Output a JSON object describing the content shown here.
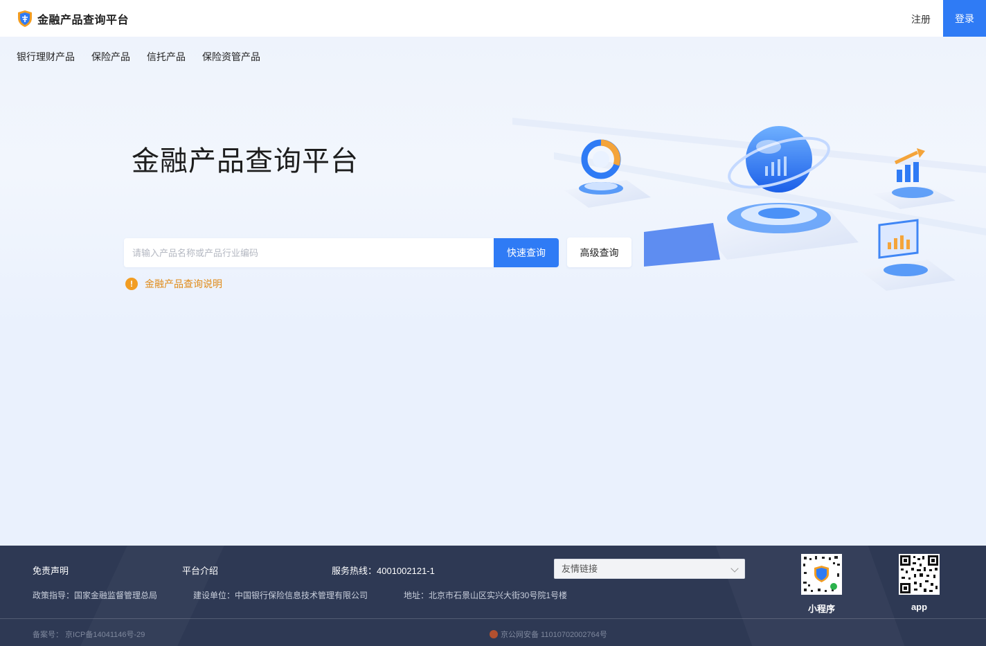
{
  "header": {
    "brand_title": "金融产品查询平台",
    "register_label": "注册",
    "login_label": "登录"
  },
  "nav": {
    "items": [
      {
        "label": "银行理财产品"
      },
      {
        "label": "保险产品"
      },
      {
        "label": "信托产品"
      },
      {
        "label": "保险资管产品"
      }
    ]
  },
  "hero": {
    "title": "金融产品查询平台",
    "search": {
      "placeholder": "请输入产品名称或产品行业编码",
      "value": "",
      "quick_button": "快速查询"
    },
    "advanced_button": "高级查询",
    "help_link": "金融产品查询说明"
  },
  "footer": {
    "disclaimer": "免责声明",
    "about": "平台介绍",
    "hotline": "服务热线：4001002121-1",
    "friend_links": {
      "selected": "友情链接"
    },
    "policy": "政策指导：国家金融监督管理总局",
    "builder": "建设单位：中国银行保险信息技术管理有限公司",
    "address": "地址：北京市石景山区实兴大街30号院1号楼",
    "mini_program_label": "小程序",
    "app_label": "app",
    "icp": "备案号： 京ICP备14041146号-29",
    "police_record": "京公网安备 11010702002764号"
  },
  "colors": {
    "primary": "#2f7bf5",
    "warning": "#f29d22",
    "footer_bg": "#2e3954",
    "page_bg": "#eaf1fd"
  },
  "icons": {
    "brand": "shield-logo-icon",
    "help": "exclamation-circle-icon",
    "select": "chevron-down-icon",
    "police": "police-badge-icon"
  }
}
